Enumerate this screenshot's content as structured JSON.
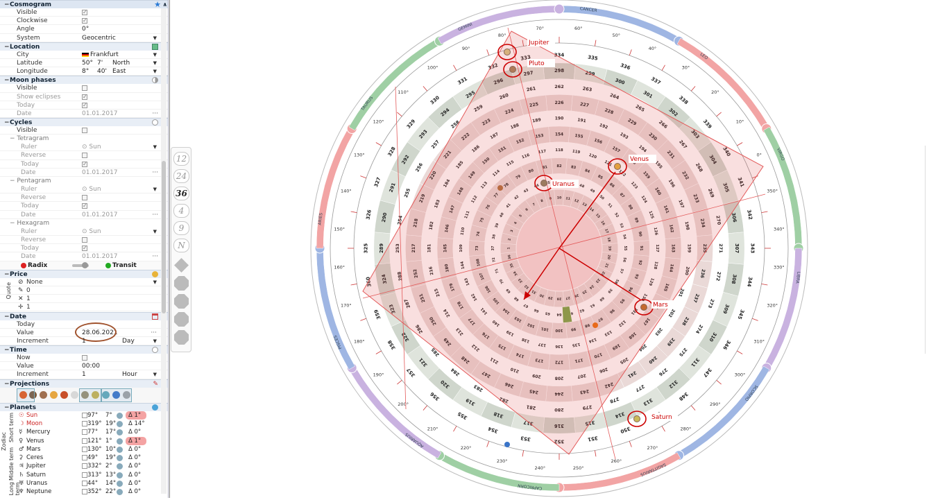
{
  "sidebar": {
    "title": "Cosmogram",
    "cosmogram": {
      "visible_label": "Visible",
      "clockwise_label": "Clockwise",
      "angle_label": "Angle",
      "angle_value": "0°",
      "system_label": "System",
      "system_value": "Geocentric"
    },
    "location": {
      "title": "Location",
      "city_label": "City",
      "city_value": "Frankfurt",
      "lat_label": "Latitude",
      "lat_deg": "50°",
      "lat_min": "7'",
      "lat_dir": "North",
      "lon_label": "Longitude",
      "lon_deg": "8°",
      "lon_min": "40'",
      "lon_dir": "East"
    },
    "moon": {
      "title": "Moon phases",
      "visible_label": "Visible",
      "eclipses_label": "Show eclipses",
      "today_label": "Today",
      "date_label": "Date",
      "date_value": "01.01.2017"
    },
    "cycles": {
      "title": "Cycles",
      "visible_label": "Visible",
      "tetragram": "Tetragram",
      "pentagram": "Pentagram",
      "hexagram": "Hexagram",
      "ruler_label": "Ruler",
      "ruler_value": "Sun",
      "reverse_label": "Reverse",
      "today_label": "Today",
      "date_label": "Date",
      "date_value": "01.01.2017"
    },
    "mode": {
      "radix": "Radix",
      "transit": "Transit"
    },
    "price": {
      "title": "Price",
      "quote_label": "Quote",
      "none_label": "None",
      "val1": "0",
      "val2": "1",
      "val3": "1"
    },
    "date": {
      "title": "Date",
      "today_label": "Today",
      "value_label": "Value",
      "value": "28.06.2021",
      "increment_label": "Increment",
      "increment_value": "1",
      "increment_unit": "Day"
    },
    "time": {
      "title": "Time",
      "now_label": "Now",
      "value_label": "Value",
      "value": "00:00",
      "increment_label": "Increment",
      "increment_value": "1",
      "increment_unit": "Hour"
    },
    "projections_title": "Projections",
    "planets_title": "Planets",
    "tabs": {
      "zodiac": "Zodiac",
      "short": "Short term",
      "middle": "Middle term",
      "long": "Long term"
    },
    "planets": [
      {
        "name": "Sun",
        "deg": "97°",
        "deg2": "7°",
        "delta": "1°",
        "hl": true,
        "red": true
      },
      {
        "name": "Moon",
        "deg": "319°",
        "deg2": "19°",
        "delta": "14°",
        "hl": false,
        "red": true
      },
      {
        "name": "Mercury",
        "deg": "77°",
        "deg2": "17°",
        "delta": "0°",
        "hl": false,
        "red": false
      },
      {
        "name": "Venus",
        "deg": "121°",
        "deg2": "1°",
        "delta": "1°",
        "hl": true,
        "red": false
      },
      {
        "name": "Mars",
        "deg": "130°",
        "deg2": "10°",
        "delta": "0°",
        "hl": false,
        "red": false
      },
      {
        "name": "Ceres",
        "deg": "49°",
        "deg2": "19°",
        "delta": "0°",
        "hl": false,
        "red": false
      },
      {
        "name": "Jupiter",
        "deg": "332°",
        "deg2": "2°",
        "delta": "0°",
        "hl": false,
        "red": false
      },
      {
        "name": "Saturn",
        "deg": "313°",
        "deg2": "13°",
        "delta": "0°",
        "hl": false,
        "red": false
      },
      {
        "name": "Uranus",
        "deg": "44°",
        "deg2": "14°",
        "delta": "0°",
        "hl": false,
        "red": false
      },
      {
        "name": "Neptune",
        "deg": "352°",
        "deg2": "22°",
        "delta": "0°",
        "hl": false,
        "red": false
      }
    ]
  },
  "toolbar": {
    "b12": "12",
    "b24": "24",
    "b36": "36",
    "b4": "4",
    "b9": "9",
    "bN": "N"
  },
  "chart": {
    "signs": [
      "CANCER",
      "LEO",
      "VIRGO",
      "LIBRA",
      "SCORPIO",
      "SAGITTARIUS",
      "CAPRICORN",
      "AQUARIUS",
      "PISCES",
      "ARIES",
      "TAURUS",
      "GEMINI"
    ],
    "labels": {
      "jupiter": "Jupiter",
      "pluto": "Pluto",
      "venus": "Venus",
      "uranus": "Uranus",
      "mars": "Mars",
      "saturn": "Saturn"
    },
    "outer_degrees": [
      "60°",
      "50°",
      "40°",
      "30°",
      "20°",
      "10°",
      "0°",
      "350°",
      "340°",
      "330°",
      "320°",
      "310°",
      "300°",
      "290°",
      "280°",
      "270°",
      "260°",
      "250°",
      "240°",
      "230°",
      "220°",
      "210°",
      "200°",
      "190°",
      "180°",
      "170°",
      "160°",
      "150°",
      "140°",
      "130°",
      "120°",
      "110°",
      "100°",
      "90°",
      "80°",
      "70°"
    ],
    "ring_numbers": [
      [
        "334",
        "335",
        "336",
        "337",
        "338",
        "339",
        "340",
        "341",
        "342",
        "343",
        "344",
        "345",
        "346",
        "347",
        "348",
        "349",
        "350",
        "351",
        "352",
        "353",
        "354",
        "355",
        "356",
        "357",
        "358",
        "359",
        "360",
        "325",
        "326",
        "327",
        "328",
        "329",
        "330",
        "331",
        "332",
        "333"
      ],
      [
        "298",
        "299",
        "300",
        "301",
        "302",
        "303",
        "304",
        "305",
        "306",
        "307",
        "308",
        "309",
        "310",
        "311",
        "312",
        "313",
        "314",
        "315",
        "316",
        "317",
        "318",
        "319",
        "320",
        "321",
        "322",
        "323",
        "324",
        "289",
        "290",
        "291",
        "292",
        "293",
        "294",
        "295",
        "296",
        "297"
      ],
      [
        "262",
        "263",
        "264",
        "265",
        "266",
        "267",
        "268",
        "269",
        "270",
        "271",
        "272",
        "273",
        "274",
        "275",
        "276",
        "277",
        "278",
        "279",
        "280",
        "281",
        "282",
        "283",
        "284",
        "285",
        "286",
        "287",
        "288",
        "253",
        "254",
        "255",
        "256",
        "257",
        "258",
        "259",
        "260",
        "261"
      ],
      [
        "226",
        "227",
        "228",
        "229",
        "230",
        "231",
        "232",
        "233",
        "234",
        "235",
        "236",
        "237",
        "238",
        "239",
        "240",
        "241",
        "242",
        "243",
        "244",
        "245",
        "246",
        "247",
        "248",
        "249",
        "250",
        "251",
        "252",
        "217",
        "218",
        "219",
        "220",
        "221",
        "222",
        "223",
        "224",
        "225"
      ],
      [
        "190",
        "191",
        "192",
        "193",
        "194",
        "195",
        "196",
        "197",
        "198",
        "199",
        "200",
        "201",
        "202",
        "203",
        "204",
        "205",
        "206",
        "207",
        "208",
        "209",
        "210",
        "211",
        "212",
        "213",
        "214",
        "215",
        "216",
        "181",
        "182",
        "183",
        "184",
        "185",
        "186",
        "187",
        "188",
        "189"
      ],
      [
        "154",
        "155",
        "156",
        "157",
        "158",
        "159",
        "160",
        "161",
        "162",
        "163",
        "164",
        "165",
        "166",
        "167",
        "168",
        "169",
        "170",
        "171",
        "172",
        "173",
        "174",
        "175",
        "176",
        "177",
        "178",
        "179",
        "180",
        "145",
        "146",
        "147",
        "148",
        "149",
        "150",
        "151",
        "152",
        "153"
      ],
      [
        "118",
        "119",
        "120",
        "121",
        "122",
        "123",
        "124",
        "125",
        "126",
        "127",
        "128",
        "129",
        "130",
        "131",
        "132",
        "133",
        "134",
        "135",
        "136",
        "137",
        "138",
        "139",
        "140",
        "141",
        "142",
        "143",
        "144",
        "109",
        "110",
        "111",
        "112",
        "113",
        "114",
        "115",
        "116",
        "117"
      ],
      [
        "82",
        "83",
        "84",
        "85",
        "86",
        "87",
        "88",
        "89",
        "90",
        "91",
        "92",
        "93",
        "94",
        "95",
        "96",
        "97",
        "98",
        "99",
        "100",
        "101",
        "102",
        "103",
        "104",
        "105",
        "106",
        "107",
        "108",
        "73",
        "74",
        "75",
        "76",
        "77",
        "78",
        "79",
        "80",
        "81"
      ],
      [
        "46",
        "47",
        "48",
        "49",
        "50",
        "51",
        "52",
        "53",
        "54",
        "55",
        "56",
        "57",
        "58",
        "59",
        "60",
        "61",
        "62",
        "63",
        "64",
        "65",
        "66",
        "67",
        "68",
        "69",
        "70",
        "71",
        "72",
        "37",
        "38",
        "39",
        "40",
        "41",
        "42",
        "43",
        "44",
        "45"
      ],
      [
        "10",
        "11",
        "12",
        "13",
        "14",
        "15",
        "16",
        "17",
        "18",
        "19",
        "20",
        "21",
        "22",
        "23",
        "24",
        "25",
        "26",
        "27",
        "28",
        "29",
        "30",
        "31",
        "32",
        "33",
        "34",
        "35",
        "36",
        "1",
        "2",
        "3",
        "4",
        "5",
        "6",
        "7",
        "8",
        "9"
      ]
    ]
  }
}
